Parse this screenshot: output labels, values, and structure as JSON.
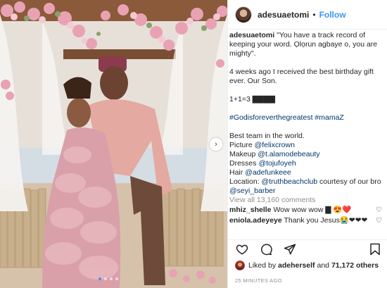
{
  "post": {
    "username": "adesuaetomi",
    "follow_label": "Follow",
    "header_separator": "•",
    "caption": {
      "username": "adesuaetomi",
      "line1": "\"You have a track record of keeping your word. Ọlọrun agbaye o, you are mighty\".",
      "line2": "4 weeks ago I received the best birthday gift ever. Our Son.",
      "line3": "1+1=3 ▇▇▇▇",
      "hashtags": "#Godisforeverthegreatest #mamaZ",
      "credits_title": "Best team in the world.",
      "picture_label": "Picture ",
      "picture_handle": "@felixcrown",
      "makeup_label": "Makeup ",
      "makeup_handle": "@t.alamodebeauty",
      "dresses_label": "Dresses ",
      "dresses_handle": "@tojufoyeh",
      "hair_label": "Hair ",
      "hair_handle": "@adefunkeee",
      "location_label": "Location: ",
      "location_handle": "@truthbeachclub",
      "location_suffix": " courtesy of our bro ",
      "bro_handle": "@seyi_barber"
    },
    "view_all": "View all 13,160 comments",
    "comments": [
      {
        "user": "mhiz_shelle",
        "text": " Wow wow wow ▇ 😍❤️"
      },
      {
        "user": "eniola.adeyeye",
        "text": " Thank you Jesus😭❤❤❤"
      }
    ],
    "likes": {
      "prefix": "Liked by ",
      "user": "adeherself",
      "middle": " and ",
      "count": "71,172 others"
    },
    "time": "25 MINUTES AGO",
    "carousel": {
      "count": 4,
      "active": 0
    }
  },
  "icons": {
    "next": "chevron-right-icon",
    "like": "heart-icon",
    "comment": "comment-bubble-icon",
    "share": "paper-plane-icon",
    "save": "bookmark-icon"
  },
  "colors": {
    "accent": "#3897f0",
    "tag": "#003569",
    "muted": "#8e8e8e"
  }
}
